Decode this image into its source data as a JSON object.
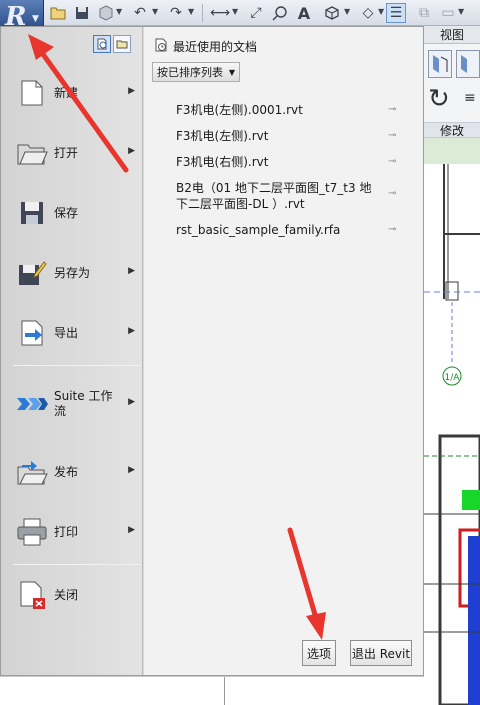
{
  "quick_access": {
    "icons": [
      "open-icon",
      "save-icon",
      "sync-icon",
      "undo-icon",
      "redo-icon",
      "measure-icon",
      "dimension-icon",
      "tag-icon",
      "text-icon",
      "3d-view-icon",
      "section-icon",
      "thin-lines-icon",
      "switch-windows-icon"
    ],
    "text_tool_glyph": "A"
  },
  "ribbon": {
    "view_tab": "视图",
    "modify_panel": "修改"
  },
  "app_menu": {
    "items": [
      {
        "label": "新建",
        "icon": "new-file-icon",
        "has_submenu": true
      },
      {
        "label": "打开",
        "icon": "open-folder-icon",
        "has_submenu": true
      },
      {
        "label": "保存",
        "icon": "save-disk-icon",
        "has_submenu": false
      },
      {
        "label": "另存为",
        "icon": "save-as-icon",
        "has_submenu": true
      },
      {
        "label": "导出",
        "icon": "export-icon",
        "has_submenu": true
      },
      {
        "label": "Suite 工作流",
        "icon": "suite-workflow-icon",
        "has_submenu": true
      },
      {
        "label": "发布",
        "icon": "publish-icon",
        "has_submenu": true
      },
      {
        "label": "打印",
        "icon": "print-icon",
        "has_submenu": true
      },
      {
        "label": "关闭",
        "icon": "close-file-icon",
        "has_submenu": false
      }
    ],
    "recent": {
      "title": "最近使用的文档",
      "sort_label": "按已排序列表",
      "documents": [
        "F3机电(左侧).0001.rvt",
        "F3机电(左侧).rvt",
        "F3机电(右侧).rvt",
        "B2电（01 地下二层平面图_t7_t3  地下二层平面图-DL  ）.rvt",
        "rst_basic_sample_family.rfa"
      ]
    },
    "options_button": "选项",
    "exit_button": "退出 Revit"
  },
  "workspace": {
    "grid_bubble": "1/A"
  },
  "colors": {
    "arrow": "#e8352e",
    "app_button": "#2c4f8e",
    "menu_bg": "#d9d9d9",
    "recent_bg": "#f2f2f2"
  }
}
